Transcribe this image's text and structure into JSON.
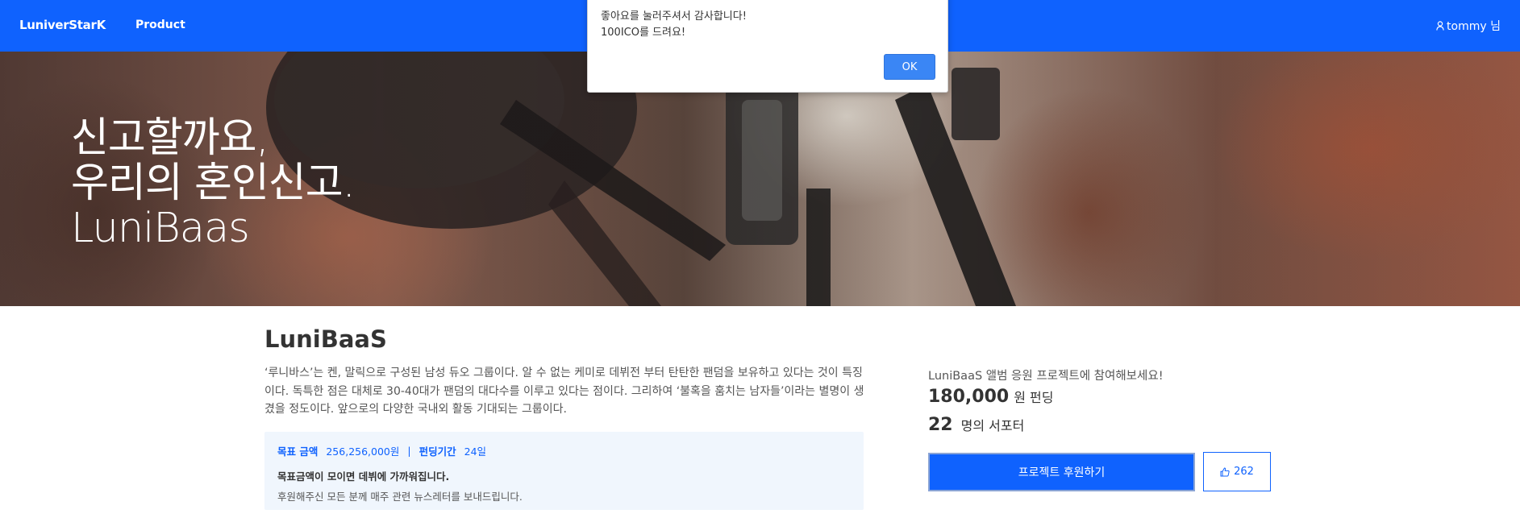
{
  "nav": {
    "brand": "LuniverStarK",
    "product_link": "Product",
    "user_name": "tommy 님"
  },
  "hero": {
    "line1": "신고할까요,",
    "line2": "우리의 혼인신고.",
    "line3": "LuniBaas"
  },
  "project": {
    "title": "LuniBaaS",
    "description": "‘루니바스’는 켄, 말릭으로 구성된 남성 듀오 그룹이다. 알 수 없는 케미로 데뷔전 부터 탄탄한 팬덤을 보유하고 있다는 것이 특징이다. 독특한 점은 대체로 30-40대가 팬덤의 대다수를 이루고 있다는 점이다. 그리하여 ‘불혹을 훔치는 남자들’이라는 별명이 생겼을 정도이다. 앞으로의 다양한 국내외 활동 기대되는 그룹이다.",
    "info": {
      "goal_label": "목표 금액",
      "goal_value": "256,256,000원",
      "separator": "|",
      "period_label": "펀딩기간",
      "period_value": "24일",
      "note_bold": "목표금액이 모이면 데뷔에 가까워집니다.",
      "note": "후원해주신 모든 분께 매주 관련 뉴스레터를 보내드립니다."
    }
  },
  "support": {
    "intro": "LuniBaaS 앨범 응원 프로젝트에 참여해보세요!",
    "amount": "180,000",
    "amount_unit": "원 펀딩",
    "supporters": "22",
    "supporters_unit": "명의 서포터",
    "support_button": "프로젝트 후원하기",
    "like_count": "262"
  },
  "alert": {
    "line1": "좋아요를 눌러주셔서 감사합니다!",
    "line2": "100ICO를 드려요!",
    "ok_button": "OK"
  },
  "colors": {
    "primary": "#0f62fe",
    "info_box_bg": "#f0f6fd"
  }
}
